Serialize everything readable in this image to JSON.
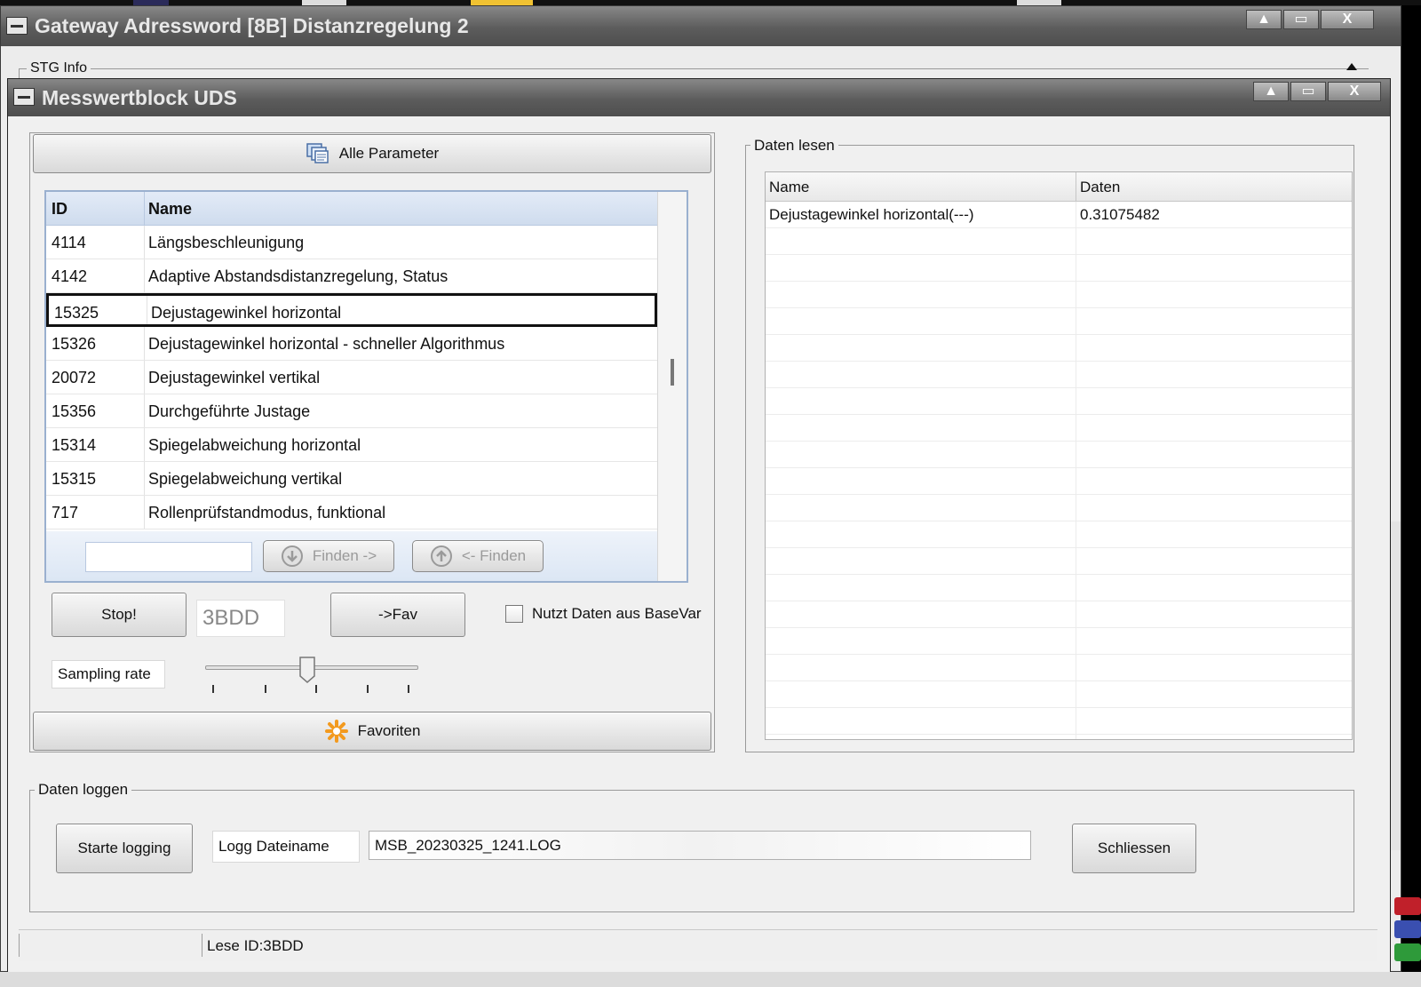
{
  "outer_window": {
    "title": "Gateway Adressword [8B] Distanzregelung 2",
    "stg_info_label": "STG Info"
  },
  "inner_window": {
    "title": "Messwertblock UDS"
  },
  "window_controls": {
    "minimize": "▲",
    "maximize": "▭",
    "close": "X"
  },
  "params": {
    "all_button": "Alle Parameter",
    "columns": {
      "id": "ID",
      "name": "Name"
    },
    "rows": [
      {
        "id": "4114",
        "name": "Längsbeschleunigung"
      },
      {
        "id": "4142",
        "name": "Adaptive Abstandsdistanzregelung, Status"
      },
      {
        "id": "15325",
        "name": "Dejustagewinkel horizontal"
      },
      {
        "id": "15326",
        "name": "Dejustagewinkel horizontal - schneller Algorithmus"
      },
      {
        "id": "20072",
        "name": "Dejustagewinkel vertikal"
      },
      {
        "id": "15356",
        "name": "Durchgeführte Justage"
      },
      {
        "id": "15314",
        "name": "Spiegelabweichung horizontal"
      },
      {
        "id": "15315",
        "name": "Spiegelabweichung vertikal"
      },
      {
        "id": "717",
        "name": "Rollenprüfstandmodus, funktional"
      }
    ],
    "selected_index": 2,
    "search_value": "",
    "find_next": "Finden ->",
    "find_prev": "<- Finden"
  },
  "controls": {
    "stop_button": "Stop!",
    "id_value": "3BDD",
    "fav_button": "->Fav",
    "basevar_label": "Nutzt Daten aus BaseVar",
    "basevar_checked": false,
    "sampling_label": "Sampling rate",
    "sampling_level": 0.48,
    "favorites_button": "Favoriten"
  },
  "data_read": {
    "group_label": "Daten lesen",
    "columns": {
      "name": "Name",
      "data": "Daten"
    },
    "rows": [
      {
        "name": "Dejustagewinkel horizontal(---)",
        "value": "0.31075482"
      }
    ]
  },
  "logging": {
    "group_label": "Daten loggen",
    "start_button": "Starte logging",
    "filename_label": "Logg Dateiname",
    "filename_value": "MSB_20230325_1241.LOG",
    "close_button": "Schliessen"
  },
  "status": {
    "text": "Lese ID:3BDD"
  },
  "colors": {
    "titlebar": "#5c5c5c",
    "list_header": "#cfdcee",
    "list_border": "#9ab0cf",
    "selection_border": "#111111",
    "favorites_icon": "#f39a1e"
  }
}
